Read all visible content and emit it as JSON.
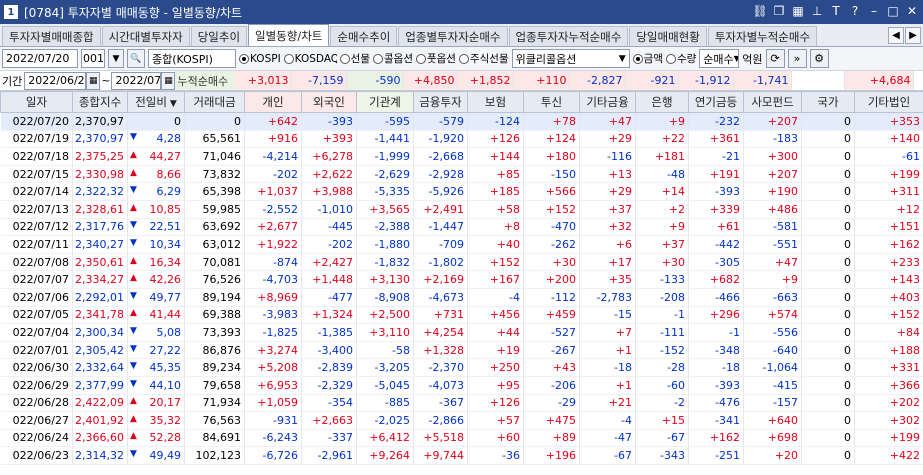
{
  "window": {
    "number": "1",
    "title": "[0784] 투자자별 매매동향 - 일별동향/차트"
  },
  "tabs": [
    "투자자별매매종합",
    "시간대별투자자",
    "당일추이",
    "일별동향/차트",
    "순매수추이",
    "업종별투자자순매수",
    "업종투자자누적순매수",
    "당일매매현황",
    "투자자별누적순매수"
  ],
  "active_tab": 3,
  "toolbar": {
    "date1": "2022/07/20",
    "code": "001",
    "search_icon": "search-icon",
    "name": "종합(KOSPI)",
    "markets": [
      "KOSPI",
      "KOSDAQ",
      "선물",
      "콜옵션",
      "풋옵션",
      "주식선물",
      "위클리콜옵션"
    ],
    "selected_market": "KOSPI",
    "option_select": "위클리콜옵션",
    "units": [
      "금액",
      "수량"
    ],
    "selected_unit": "금액",
    "sort": "순매수",
    "unit_label": "억원"
  },
  "range": {
    "label": "기간",
    "from": "2022/06/20",
    "sep": "~",
    "to": "2022/07/20",
    "sum_label": "누적순매수",
    "sums": [
      "+3,013",
      "-7,159",
      "-590",
      "+4,850",
      "+1,852",
      "+110",
      "-2,827",
      "-921",
      "-1,912",
      "-1,741",
      "",
      "+4,684"
    ]
  },
  "columns": [
    "일자",
    "종합지수",
    "전일비",
    "거래대금",
    "개인",
    "외국인",
    "기관계",
    "금융투자",
    "보험",
    "투신",
    "기타금융",
    "은행",
    "연기금등",
    "사모펀드",
    "국가",
    "기타법인"
  ],
  "rows": [
    {
      "d": "022/07/20",
      "idx": "2,370,97",
      "dir": "",
      "chg": "0",
      "vol": "0",
      "v": [
        "+642",
        "-393",
        "-595",
        "-579",
        "-124",
        "+78",
        "+47",
        "+9",
        "-232",
        "+207",
        "0",
        "+353"
      ]
    },
    {
      "d": "022/07/19",
      "idx": "2,370,97",
      "dir": "dn",
      "chg": "4,28",
      "vol": "65,561",
      "v": [
        "+916",
        "+393",
        "-1,441",
        "-1,920",
        "+126",
        "+124",
        "+29",
        "+22",
        "+361",
        "-183",
        "0",
        "+140"
      ]
    },
    {
      "d": "022/07/18",
      "idx": "2,375,25",
      "dir": "up",
      "chg": "44,27",
      "vol": "71,046",
      "v": [
        "-4,214",
        "+6,278",
        "-1,999",
        "-2,668",
        "+144",
        "+180",
        "-116",
        "+181",
        "-21",
        "+300",
        "0",
        "-61"
      ]
    },
    {
      "d": "022/07/15",
      "idx": "2,330,98",
      "dir": "up",
      "chg": "8,66",
      "vol": "73,832",
      "v": [
        "-202",
        "+2,622",
        "-2,629",
        "-2,928",
        "+85",
        "-150",
        "+13",
        "-48",
        "+191",
        "+207",
        "0",
        "+199"
      ]
    },
    {
      "d": "022/07/14",
      "idx": "2,322,32",
      "dir": "dn",
      "chg": "6,29",
      "vol": "65,398",
      "v": [
        "+1,037",
        "+3,988",
        "-5,335",
        "-5,926",
        "+185",
        "+566",
        "+29",
        "+14",
        "-393",
        "+190",
        "0",
        "+311"
      ]
    },
    {
      "d": "022/07/13",
      "idx": "2,328,61",
      "dir": "up",
      "chg": "10,85",
      "vol": "59,985",
      "v": [
        "-2,552",
        "-1,010",
        "+3,565",
        "+2,491",
        "+58",
        "+152",
        "+37",
        "+2",
        "+339",
        "+486",
        "0",
        "+12"
      ]
    },
    {
      "d": "022/07/12",
      "idx": "2,317,76",
      "dir": "dn",
      "chg": "22,51",
      "vol": "63,692",
      "v": [
        "+2,677",
        "-445",
        "-2,388",
        "-1,447",
        "+8",
        "-470",
        "+32",
        "+9",
        "+61",
        "-581",
        "0",
        "+151"
      ]
    },
    {
      "d": "022/07/11",
      "idx": "2,340,27",
      "dir": "dn",
      "chg": "10,34",
      "vol": "63,012",
      "v": [
        "+1,922",
        "-202",
        "-1,880",
        "-709",
        "+40",
        "-262",
        "+6",
        "+37",
        "-442",
        "-551",
        "0",
        "+162"
      ]
    },
    {
      "d": "022/07/08",
      "idx": "2,350,61",
      "dir": "up",
      "chg": "16,34",
      "vol": "70,081",
      "v": [
        "-874",
        "+2,427",
        "-1,832",
        "-1,802",
        "+152",
        "+30",
        "+17",
        "+30",
        "-305",
        "+47",
        "0",
        "+233"
      ]
    },
    {
      "d": "022/07/07",
      "idx": "2,334,27",
      "dir": "up",
      "chg": "42,26",
      "vol": "76,526",
      "v": [
        "-4,703",
        "+1,448",
        "+3,130",
        "+2,169",
        "+167",
        "+200",
        "+35",
        "-133",
        "+682",
        "+9",
        "0",
        "+143"
      ]
    },
    {
      "d": "022/07/06",
      "idx": "2,292,01",
      "dir": "dn",
      "chg": "49,77",
      "vol": "89,194",
      "v": [
        "+8,969",
        "-477",
        "-8,908",
        "-4,673",
        "-4",
        "-112",
        "-2,783",
        "-208",
        "-466",
        "-663",
        "0",
        "+403"
      ]
    },
    {
      "d": "022/07/05",
      "idx": "2,341,78",
      "dir": "up",
      "chg": "41,44",
      "vol": "69,388",
      "v": [
        "-3,983",
        "+1,324",
        "+2,500",
        "+731",
        "+456",
        "+459",
        "-15",
        "-1",
        "+296",
        "+574",
        "0",
        "+152"
      ]
    },
    {
      "d": "022/07/04",
      "idx": "2,300,34",
      "dir": "dn",
      "chg": "5,08",
      "vol": "73,393",
      "v": [
        "-1,825",
        "-1,385",
        "+3,110",
        "+4,254",
        "+44",
        "-527",
        "+7",
        "-111",
        "-1",
        "-556",
        "0",
        "+84"
      ]
    },
    {
      "d": "022/07/01",
      "idx": "2,305,42",
      "dir": "dn",
      "chg": "27,22",
      "vol": "86,876",
      "v": [
        "+3,274",
        "-3,400",
        "-58",
        "+1,328",
        "+19",
        "-267",
        "+1",
        "-152",
        "-348",
        "-640",
        "0",
        "+188"
      ]
    },
    {
      "d": "022/06/30",
      "idx": "2,332,64",
      "dir": "dn",
      "chg": "45,35",
      "vol": "89,234",
      "v": [
        "+5,208",
        "-2,839",
        "-3,205",
        "-2,370",
        "+250",
        "+43",
        "-18",
        "-28",
        "-18",
        "-1,064",
        "0",
        "+331"
      ]
    },
    {
      "d": "022/06/29",
      "idx": "2,377,99",
      "dir": "dn",
      "chg": "44,10",
      "vol": "79,658",
      "v": [
        "+6,953",
        "-2,329",
        "-5,045",
        "-4,073",
        "+95",
        "-206",
        "+1",
        "-60",
        "-393",
        "-415",
        "0",
        "+366"
      ]
    },
    {
      "d": "022/06/28",
      "idx": "2,422,09",
      "dir": "up",
      "chg": "20,17",
      "vol": "71,934",
      "v": [
        "+1,059",
        "-354",
        "-885",
        "-367",
        "+126",
        "-29",
        "+21",
        "-2",
        "-476",
        "-157",
        "0",
        "+202"
      ]
    },
    {
      "d": "022/06/27",
      "idx": "2,401,92",
      "dir": "up",
      "chg": "35,32",
      "vol": "76,563",
      "v": [
        "-931",
        "+2,663",
        "-2,025",
        "-2,866",
        "+57",
        "+475",
        "-4",
        "+15",
        "-341",
        "+640",
        "0",
        "+302"
      ]
    },
    {
      "d": "022/06/24",
      "idx": "2,366,60",
      "dir": "up",
      "chg": "52,28",
      "vol": "84,691",
      "v": [
        "-6,243",
        "-337",
        "+6,412",
        "+5,518",
        "+60",
        "+89",
        "-47",
        "-67",
        "+162",
        "+698",
        "0",
        "+199"
      ]
    },
    {
      "d": "022/06/23",
      "idx": "2,314,32",
      "dir": "dn",
      "chg": "49,49",
      "vol": "102,123",
      "v": [
        "-6,726",
        "-2,961",
        "+9,264",
        "+9,744",
        "-36",
        "+196",
        "-67",
        "-343",
        "-251",
        "+20",
        "0",
        "+422"
      ]
    }
  ],
  "colors": {
    "up": "#e0001b",
    "down": "#0032c8",
    "title_bar": "#2b4a8c",
    "header_bg": "#e6ebf3"
  }
}
